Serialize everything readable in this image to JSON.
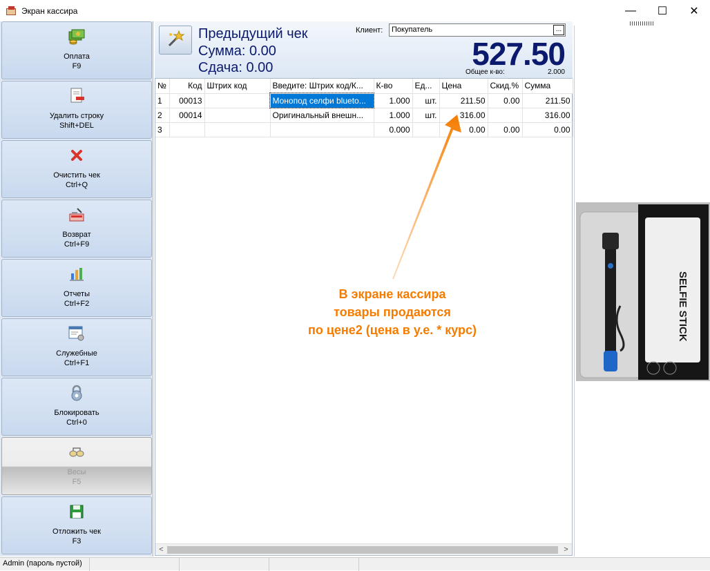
{
  "window": {
    "title": "Экран кассира",
    "minimize": "—",
    "maximize": "☐",
    "close": "✕"
  },
  "sidebar": {
    "buttons": [
      {
        "label": "Оплата",
        "hotkey": "F9",
        "icon": "cash-icon"
      },
      {
        "label": "Удалить строку",
        "hotkey": "Shift+DEL",
        "icon": "delete-row-icon"
      },
      {
        "label": "Очистить чек",
        "hotkey": "Ctrl+Q",
        "icon": "clear-icon"
      },
      {
        "label": "Возврат",
        "hotkey": "Ctrl+F9",
        "icon": "return-icon"
      },
      {
        "label": "Отчеты",
        "hotkey": "Ctrl+F2",
        "icon": "reports-icon"
      },
      {
        "label": "Служебные",
        "hotkey": "Ctrl+F1",
        "icon": "service-icon"
      },
      {
        "label": "Блокировать",
        "hotkey": "Ctrl+0",
        "icon": "lock-icon"
      },
      {
        "label": "Весы",
        "hotkey": "F5",
        "icon": "scales-icon",
        "disabled": true
      },
      {
        "label": "Отложить чек",
        "hotkey": "F3",
        "icon": "save-icon"
      }
    ]
  },
  "receipt": {
    "previous_title": "Предыдущий чек",
    "sum_line": "Сумма: 0.00",
    "change_line": "Сдача: 0.00",
    "client_label": "Клиент:",
    "client_value": "Покупатель",
    "client_button": "...",
    "total": "527.50",
    "qty_label": "Общее к-во:",
    "qty_value": "2.000"
  },
  "table": {
    "columns": [
      "№",
      "Код",
      "Штрих код",
      "Введите: Штрих код/К...",
      "К-во",
      "Ед...",
      "Цена",
      "Скид.%",
      "Сумма"
    ],
    "rows": [
      [
        "1",
        "00013",
        "",
        "Монопод селфи blueto...",
        "1.000",
        "шт.",
        "211.50",
        "0.00",
        "211.50"
      ],
      [
        "2",
        "00014",
        "",
        "Оригинальный внешн...",
        "1.000",
        "шт.",
        "316.00",
        "",
        "316.00"
      ],
      [
        "3",
        "",
        "",
        "",
        "0.000",
        "",
        "0.00",
        "0.00",
        "0.00"
      ]
    ]
  },
  "annotation": {
    "line1": "В экране кассира",
    "line2": "товары продаются",
    "line3": "по цене2 (цена в у.е. * курс)",
    "color": "#f57c00"
  },
  "product_image": {
    "brand_text": "SELFIE STICK"
  },
  "status": {
    "user": "Admin (пароль пустой)"
  },
  "colors": {
    "total": "#0c1a6e",
    "selection": "#0078d7",
    "sidebar": "#dfe8f3"
  }
}
